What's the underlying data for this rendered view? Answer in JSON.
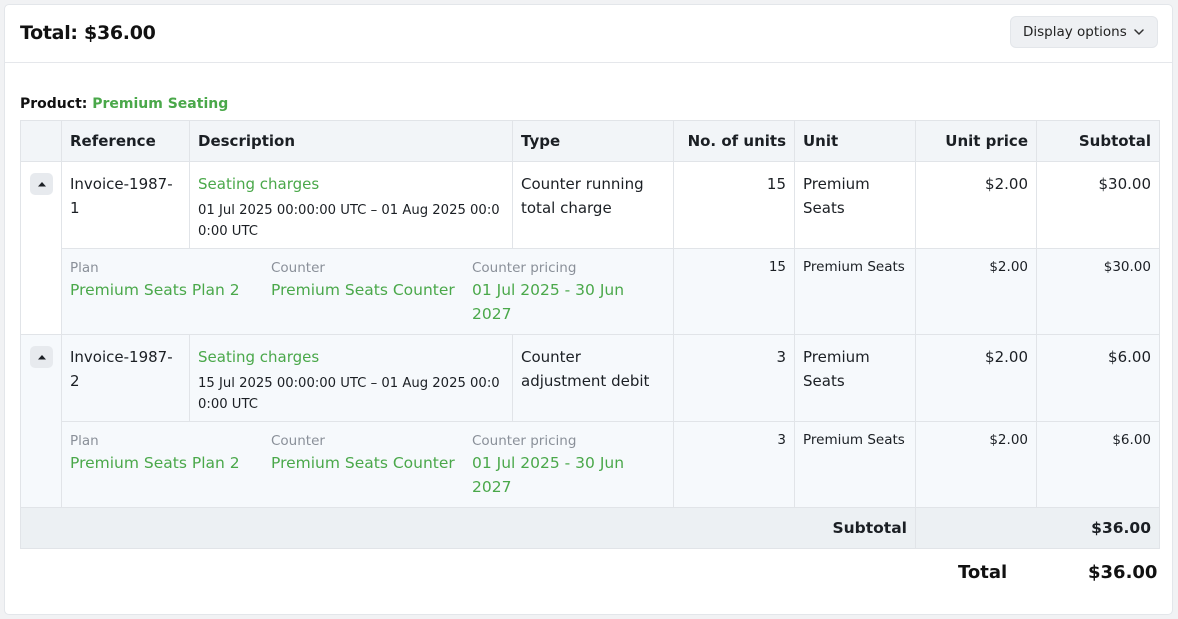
{
  "header": {
    "total_label": "Total: $36.00",
    "display_options_label": "Display options"
  },
  "product": {
    "prefix": "Product:",
    "name": "Premium Seating"
  },
  "table": {
    "columns": [
      "Reference",
      "Description",
      "Type",
      "No. of units",
      "Unit",
      "Unit price",
      "Subtotal"
    ],
    "rows": [
      {
        "reference": "Invoice-1987-1",
        "description": "Seating charges",
        "period": "01 Jul 2025 00:00:00 UTC – 01 Aug 2025 00:00:00 UTC",
        "type": "Counter running total charge",
        "units": "15",
        "unit": "Premium Seats",
        "unit_price": "$2.00",
        "subtotal": "$30.00",
        "detail": {
          "plan_label": "Plan",
          "plan": "Premium Seats Plan 2",
          "counter_label": "Counter",
          "counter": "Premium Seats Counter",
          "pricing_label": "Counter pricing",
          "pricing": "01 Jul 2025 - 30 Jun 2027",
          "units": "15",
          "unit": "Premium Seats",
          "unit_price": "$2.00",
          "subtotal": "$30.00"
        }
      },
      {
        "reference": "Invoice-1987-2",
        "description": "Seating charges",
        "period": "15 Jul 2025 00:00:00 UTC – 01 Aug 2025 00:00:00 UTC",
        "type": "Counter adjustment debit",
        "units": "3",
        "unit": "Premium Seats",
        "unit_price": "$2.00",
        "subtotal": "$6.00",
        "detail": {
          "plan_label": "Plan",
          "plan": "Premium Seats Plan 2",
          "counter_label": "Counter",
          "counter": "Premium Seats Counter",
          "pricing_label": "Counter pricing",
          "pricing": "01 Jul 2025 - 30 Jun 2027",
          "units": "3",
          "unit": "Premium Seats",
          "unit_price": "$2.00",
          "subtotal": "$6.00"
        }
      }
    ],
    "subtotal_label": "Subtotal",
    "subtotal_value": "$36.00"
  },
  "footer": {
    "total_label": "Total",
    "total_value": "$36.00"
  },
  "colors": {
    "accent_green": "#4aa84a",
    "header_bg": "#f2f5f8"
  }
}
